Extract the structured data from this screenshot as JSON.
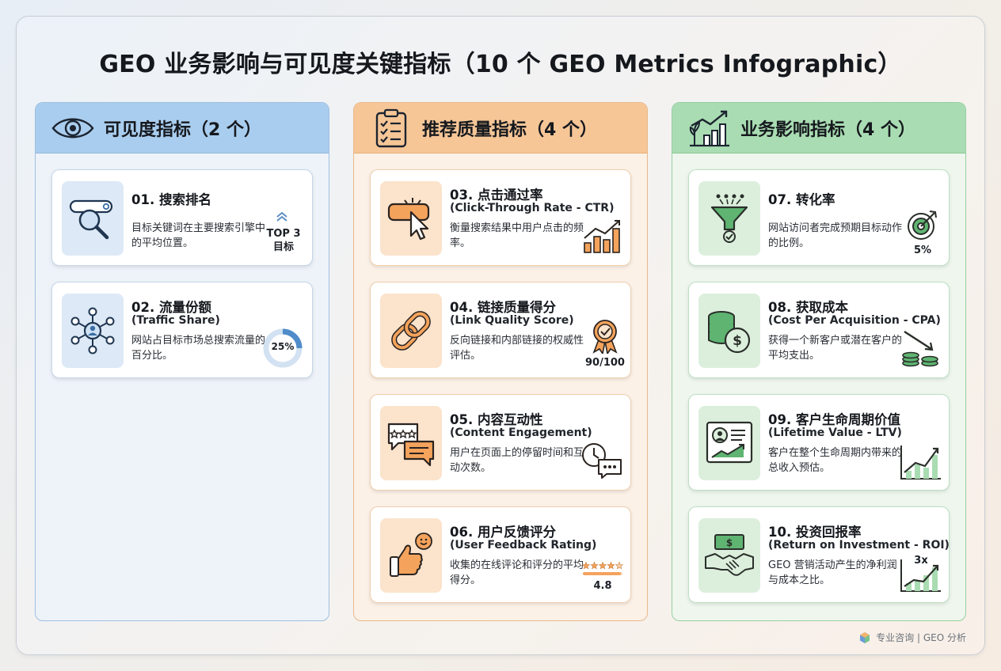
{
  "title": "GEO 业务影响与可见度关键指标（10 个 GEO Metrics Infographic）",
  "columns": [
    {
      "heading": "可见度指标（2 个）",
      "cards": [
        {
          "title": "01. 搜索排名",
          "subtitle": "",
          "desc": "目标关键词在主要搜索引擎中的平均位置。",
          "badge": "TOP 3 目标",
          "icon": "search-bar-magnifier-icon"
        },
        {
          "title": "02. 流量份额",
          "subtitle": "(Traffic Share)",
          "desc": "网站占目标市场总搜索流量的百分比。",
          "badge": "25%",
          "badge_value": 25,
          "icon": "network-hub-icon"
        }
      ]
    },
    {
      "heading": "推荐质量指标（4 个）",
      "cards": [
        {
          "title": "03. 点击通过率",
          "subtitle": "(Click-Through Rate - CTR)",
          "desc": "衡量搜索结果中用户点击的频率。",
          "badge": "",
          "icon": "click-cursor-icon"
        },
        {
          "title": "04. 链接质量得分",
          "subtitle": "(Link Quality Score)",
          "desc": "反向链接和内部链接的权威性评估。",
          "badge": "90/100",
          "icon": "chain-link-icon"
        },
        {
          "title": "05. 内容互动性",
          "subtitle": "(Content Engagement)",
          "desc": "用户在页面上的停留时间和互动次数。",
          "badge": "",
          "icon": "chat-bubbles-icon"
        },
        {
          "title": "06. 用户反馈评分",
          "subtitle": "(User Feedback Rating)",
          "desc": "收集的在线评论和评分的平均得分。",
          "badge": "4.8",
          "rating": 4.8,
          "icon": "thumbs-up-icon"
        }
      ]
    },
    {
      "heading": "业务影响指标（4 个）",
      "cards": [
        {
          "title": "07. 转化率",
          "subtitle": "",
          "desc": "网站访问者完成预期目标动作的比例。",
          "badge": "5%",
          "icon": "funnel-icon"
        },
        {
          "title": "08. 获取成本",
          "subtitle": "(Cost Per Acquisition - CPA)",
          "desc": "获得一个新客户或潜在客户的平均支出。",
          "badge": "",
          "icon": "coin-stack-icon"
        },
        {
          "title": "09. 客户生命周期价值",
          "subtitle": "(Lifetime Value - LTV)",
          "desc": "客户在整个生命周期内带来的总收入预估。",
          "badge": "",
          "icon": "profile-chart-icon"
        },
        {
          "title": "10. 投资回报率",
          "subtitle": "(Return on Investment - ROI)",
          "desc": "GEO 营销活动产生的净利润与成本之比。",
          "badge": "3x",
          "icon": "handshake-money-icon"
        }
      ]
    }
  ],
  "footer": "专业咨询 | GEO 分析",
  "colors": {
    "blue": "#a9cdee",
    "orange": "#f6c697",
    "green": "#a9dcb2",
    "icon_blue": "#3a6ea5",
    "icon_orange": "#e08a3c",
    "icon_green": "#3f9a55"
  }
}
